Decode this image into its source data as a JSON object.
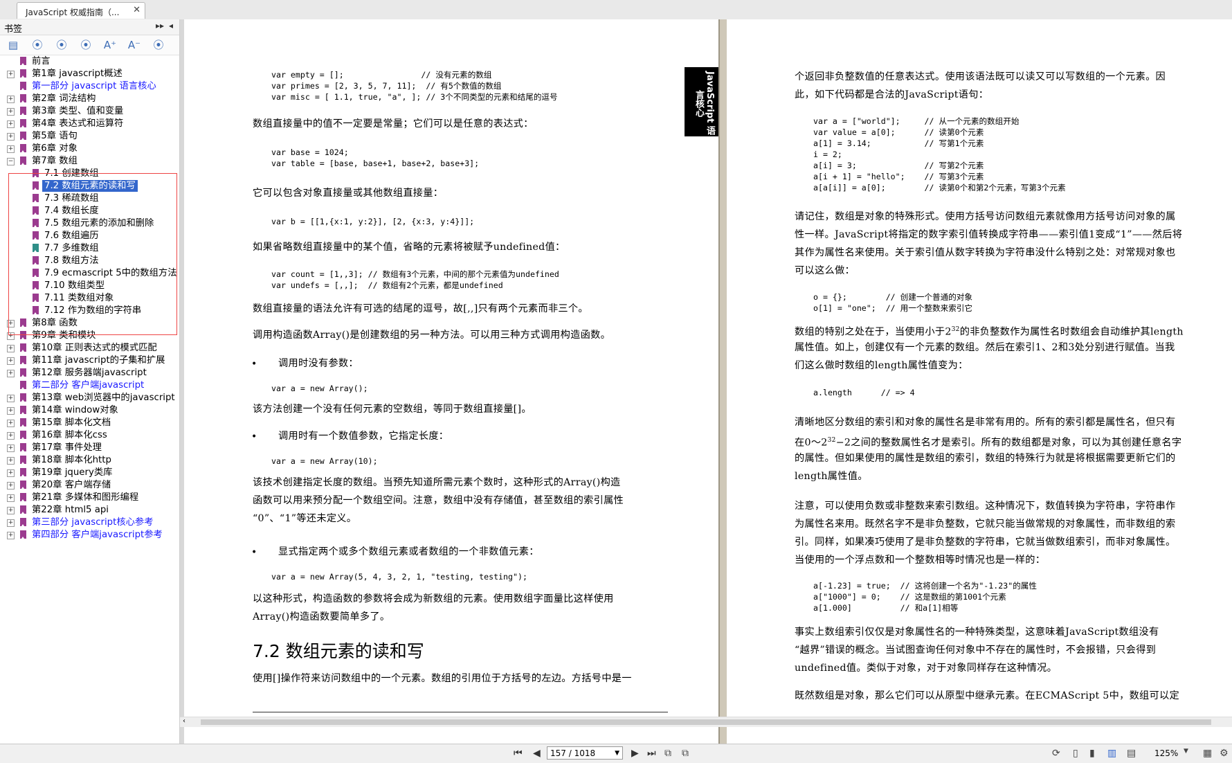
{
  "tab": {
    "title": "JavaScript 权威指南（...",
    "close": "✕"
  },
  "sidebar": {
    "title": "书签",
    "controls": {
      "pin": "▸▸",
      "collapse": "◂"
    },
    "toolbar_icons": [
      "bookmark-list-icon",
      "bookmark-add-icon",
      "bookmark-expand-icon",
      "bookmark-collapse-icon",
      "font-increase-icon",
      "font-decrease-icon",
      "bookmark-settings-icon"
    ],
    "toolbar_glyphs": [
      "▤",
      "⦿",
      "⦿",
      "⦿",
      "A⁺",
      "A⁻",
      "⦿"
    ],
    "items": [
      {
        "label": "前言",
        "level": 0,
        "expander": false,
        "blue": false
      },
      {
        "label": "第1章 javascript概述",
        "level": 0,
        "expander": true,
        "blue": false
      },
      {
        "label": "第一部分 javascript 语言核心",
        "level": 0,
        "expander": false,
        "blue": true
      },
      {
        "label": "第2章 词法结构",
        "level": 0,
        "expander": true,
        "blue": false
      },
      {
        "label": "第3章 类型、值和变量",
        "level": 0,
        "expander": true,
        "blue": false
      },
      {
        "label": "第4章 表达式和运算符",
        "level": 0,
        "expander": true,
        "blue": false
      },
      {
        "label": "第5章 语句",
        "level": 0,
        "expander": true,
        "blue": false
      },
      {
        "label": "第6章 对象",
        "level": 0,
        "expander": true,
        "blue": false
      },
      {
        "label": "第7章 数组",
        "level": 0,
        "expander": true,
        "expanded": true,
        "blue": false
      },
      {
        "label": "7.1 创建数组",
        "level": 1,
        "blue": false
      },
      {
        "label": "7.2 数组元素的读和写",
        "level": 1,
        "blue": false,
        "selected": true
      },
      {
        "label": "7.3 稀疏数组",
        "level": 1,
        "blue": false
      },
      {
        "label": "7.4 数组长度",
        "level": 1,
        "blue": false
      },
      {
        "label": "7.5 数组元素的添加和删除",
        "level": 1,
        "blue": false
      },
      {
        "label": "7.6 数组遍历",
        "level": 1,
        "blue": false
      },
      {
        "label": "7.7 多维数组",
        "level": 1,
        "blue": false,
        "teal": true
      },
      {
        "label": "7.8 数组方法",
        "level": 1,
        "blue": false
      },
      {
        "label": "7.9 ecmascript 5中的数组方法",
        "level": 1,
        "blue": false
      },
      {
        "label": "7.10 数组类型",
        "level": 1,
        "blue": false
      },
      {
        "label": "7.11 类数组对象",
        "level": 1,
        "blue": false
      },
      {
        "label": "7.12 作为数组的字符串",
        "level": 1,
        "blue": false
      },
      {
        "label": "第8章 函数",
        "level": 0,
        "expander": true,
        "blue": false
      },
      {
        "label": "第9章 类和模块",
        "level": 0,
        "expander": true,
        "blue": false
      },
      {
        "label": "第10章 正则表达式的模式匹配",
        "level": 0,
        "expander": true,
        "blue": false
      },
      {
        "label": "第11章 javascript的子集和扩展",
        "level": 0,
        "expander": true,
        "blue": false
      },
      {
        "label": "第12章 服务器端javascript",
        "level": 0,
        "expander": true,
        "blue": false
      },
      {
        "label": "第二部分 客户端javascript",
        "level": 0,
        "expander": false,
        "blue": true
      },
      {
        "label": "第13章 web浏览器中的javascript",
        "level": 0,
        "expander": true,
        "blue": false
      },
      {
        "label": "第14章 window对象",
        "level": 0,
        "expander": true,
        "blue": false
      },
      {
        "label": "第15章 脚本化文档",
        "level": 0,
        "expander": true,
        "blue": false
      },
      {
        "label": "第16章 脚本化css",
        "level": 0,
        "expander": true,
        "blue": false
      },
      {
        "label": "第17章 事件处理",
        "level": 0,
        "expander": true,
        "blue": false
      },
      {
        "label": "第18章 脚本化http",
        "level": 0,
        "expander": true,
        "blue": false
      },
      {
        "label": "第19章 jquery类库",
        "level": 0,
        "expander": true,
        "blue": false
      },
      {
        "label": "第20章 客户端存储",
        "level": 0,
        "expander": true,
        "blue": false
      },
      {
        "label": "第21章 多媒体和图形编程",
        "level": 0,
        "expander": true,
        "blue": false
      },
      {
        "label": "第22章 html5 api",
        "level": 0,
        "expander": true,
        "blue": false
      },
      {
        "label": "第三部分 javascript核心参考",
        "level": 0,
        "expander": true,
        "blue": true
      },
      {
        "label": "第四部分 客户端javascript参考",
        "level": 0,
        "expander": true,
        "blue": true
      }
    ]
  },
  "left_page": {
    "code1": "var empty = [];                // 没有元素的数组\nvar primes = [2, 3, 5, 7, 11];  // 有5个数值的数组\nvar misc = [ 1.1, true, \"a\", ]; // 3个不同类型的元素和结尾的逗号",
    "p1": "数组直接量中的值不一定要是常量；它们可以是任意的表达式：",
    "code2": "var base = 1024;\nvar table = [base, base+1, base+2, base+3];",
    "p2": "它可以包含对象直接量或其他数组直接量：",
    "code3": "var b = [[1,{x:1, y:2}], [2, {x:3, y:4}]];",
    "p3": "如果省略数组直接量中的某个值，省略的元素将被赋予undefined值：",
    "code4": "var count = [1,,3]; // 数组有3个元素，中间的那个元素值为undefined\nvar undefs = [,,];  // 数组有2个元素，都是undefined",
    "p4": "数组直接量的语法允许有可选的结尾的逗号，故[,,]只有两个元素而非三个。",
    "p5": "调用构造函数Array()是创建数组的另一种方法。可以用三种方式调用构造函数。",
    "b1": "调用时没有参数：",
    "code5": "var a = new Array();",
    "p6": "该方法创建一个没有任何元素的空数组，等同于数组直接量[]。",
    "b2": "调用时有一个数值参数，它指定长度：",
    "code6": "var a = new Array(10);",
    "p7a": "该技术创建指定长度的数组。当预先知道所需元素个数时，这种形式的Array()构造",
    "p7b": "函数可以用来预分配一个数组空间。注意，数组中没有存储值，甚至数组的索引属性",
    "p7c": "“0”、“1”等还未定义。",
    "b3": "显式指定两个或多个数组元素或者数组的一个非数值元素：",
    "code7": "var a = new Array(5, 4, 3, 2, 1, \"testing, testing\");",
    "p8a": "以这种形式，构造函数的参数将会成为新数组的元素。使用数组字面量比这样使用",
    "p8b": "Array()构造函数要简单多了。",
    "heading": "7.2 数组元素的读和写",
    "p9": "使用[]操作符来访问数组中的一个元素。数组的引用位于方括号的左边。方括号中是一",
    "bullet_glyph": "•"
  },
  "side_tab": "JavaScript 语言核心",
  "right_page": {
    "p1a": "个返回非负整数值的任意表达式。使用该语法既可以读又可以写数组的一个元素。因",
    "p1b": "此，如下代码都是合法的JavaScript语句：",
    "code1": "var a = [\"world\"];     // 从一个元素的数组开始\nvar value = a[0];      // 读第0个元素\na[1] = 3.14;           // 写第1个元素\ni = 2;\na[i] = 3;              // 写第2个元素\na[i + 1] = \"hello\";    // 写第3个元素\na[a[i]] = a[0];        // 读第0个和第2个元素，写第3个元素",
    "p2a": "请记住，数组是对象的特殊形式。使用方括号访问数组元素就像用方括号访问对象的属",
    "p2b": "性一样。JavaScript将指定的数字索引值转换成字符串——索引值1变成“1”——然后将",
    "p2c": "其作为属性名来使用。关于索引值从数字转换为字符串没什么特别之处：对常规对象也",
    "p2d": "可以这么做：",
    "code2": "o = {};        // 创建一个普通的对象\no[1] = \"one\";  // 用一个整数来索引它",
    "p3a_pre": "数组的特别之处在于，当使用小于2",
    "p3a_sup": "32",
    "p3a_post": "的非负整数作为属性名时数组会自动维护其length",
    "p3b": "属性值。如上，创建仅有一个元素的数组。然后在索引1、2和3处分别进行赋值。当我",
    "p3c": "们这么做时数组的length属性值变为：",
    "code3": "a.length      // => 4",
    "p4a": "清晰地区分数组的索引和对象的属性名是非常有用的。所有的索引都是属性名，但只有",
    "p4b_pre": "在0～2",
    "p4b_sup": "32",
    "p4b_post": "−2之间的整数属性名才是索引。所有的数组都是对象，可以为其创建任意名字",
    "p4c": "的属性。但如果使用的属性是数组的索引，数组的特殊行为就是将根据需要更新它们的",
    "p4d": "length属性值。",
    "p5a": "注意，可以使用负数或非整数来索引数组。这种情况下，数值转换为字符串，字符串作",
    "p5b": "为属性名来用。既然名字不是非负整数，它就只能当做常规的对象属性，而非数组的索",
    "p5c": "引。同样，如果凑巧使用了是非负整数的字符串，它就当做数组索引，而非对象属性。",
    "p5d": "当使用的一个浮点数和一个整数相等时情况也是一样的：",
    "code4": "a[-1.23] = true;  // 这将创建一个名为\"-1.23\"的属性\na[\"1000\"] = 0;    // 这是数组的第1001个元素\na[1.000]          // 和a[1]相等",
    "p6a": "事实上数组索引仅仅是对象属性名的一种特殊类型，这意味着JavaScript数组没有",
    "p6b": "“越界”错误的概念。当试图查询任何对象中不存在的属性时，不会报错，只会得到",
    "p6c": "undefined值。类似于对象，对于对象同样存在这种情况。",
    "p7": "既然数组是对象，那么它们可以从原型中继承元素。在ECMAScript 5中，数组可以定"
  },
  "statusbar": {
    "page_value": "157 / 1018",
    "zoom": "125%",
    "first": "⏮",
    "prev": "◀",
    "next": "▶",
    "last": "⏭"
  }
}
